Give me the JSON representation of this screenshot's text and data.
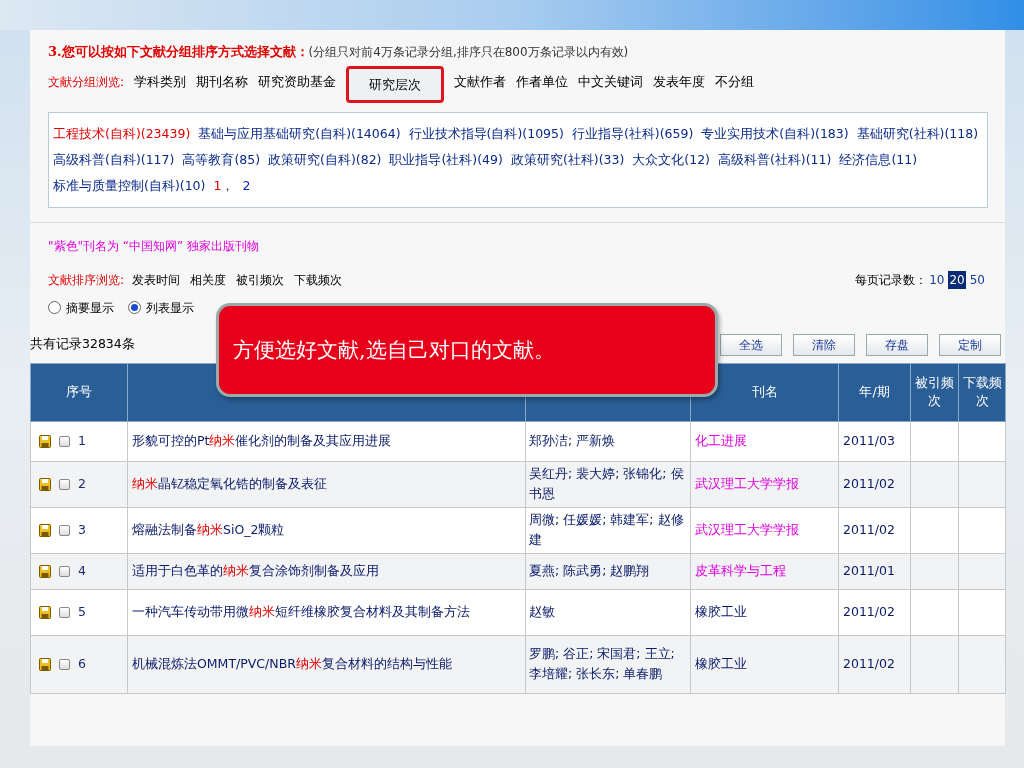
{
  "heading": {
    "title": "3.您可以按如下文献分组排序方式选择文献：",
    "note": "(分组只对前4万条记录分组,排序只在800万条记录以内有效)"
  },
  "group_nav": {
    "label": "文献分组浏览:",
    "items": [
      {
        "label": "学科类别",
        "selected": false
      },
      {
        "label": "期刊名称",
        "selected": false
      },
      {
        "label": "研究资助基金",
        "selected": false
      },
      {
        "label": "研究层次",
        "selected": true
      },
      {
        "label": "文献作者",
        "selected": false
      },
      {
        "label": "作者单位",
        "selected": false
      },
      {
        "label": "中文关键词",
        "selected": false
      },
      {
        "label": "发表年度",
        "selected": false
      },
      {
        "label": "不分组",
        "selected": false
      }
    ]
  },
  "groups": [
    {
      "label": "工程技术(自科)(23439)",
      "selected": true
    },
    {
      "label": "基础与应用基础研究(自科)(14064)",
      "selected": false
    },
    {
      "label": "行业技术指导(自科)(1095)",
      "selected": false
    },
    {
      "label": "行业指导(社科)(659)",
      "selected": false
    },
    {
      "label": "专业实用技术(自科)(183)",
      "selected": false
    },
    {
      "label": "基础研究(社科)(118)",
      "selected": false
    },
    {
      "label": "高级科普(自科)(117)",
      "selected": false
    },
    {
      "label": "高等教育(85)",
      "selected": false
    },
    {
      "label": "政策研究(自科)(82)",
      "selected": false
    },
    {
      "label": "职业指导(社科)(49)",
      "selected": false
    },
    {
      "label": "政策研究(社科)(33)",
      "selected": false
    },
    {
      "label": "大众文化(12)",
      "selected": false
    },
    {
      "label": "高级科普(社科)(11)",
      "selected": false
    },
    {
      "label": "经济信息(11)",
      "selected": false
    },
    {
      "label": "标准与质量控制(自科)(10)",
      "selected": false
    }
  ],
  "group_pages": [
    {
      "label": "1",
      "selected": true
    },
    {
      "label": "2",
      "selected": false
    }
  ],
  "group_pages_separator": "，",
  "exclusive_note": "\"紫色\"刊名为 “中国知网” 独家出版刊物",
  "sort_nav": {
    "label": "文献排序浏览:",
    "items": [
      "发表时间",
      "相关度",
      "被引频次",
      "下载频次"
    ]
  },
  "per_page": {
    "label": "每页记录数：",
    "options": [
      {
        "label": "10",
        "selected": false
      },
      {
        "label": "20",
        "selected": true
      },
      {
        "label": "50",
        "selected": false
      }
    ]
  },
  "display_modes": [
    {
      "label": "摘要显示",
      "selected": false
    },
    {
      "label": "列表显示",
      "selected": true
    }
  ],
  "total": "共有记录32834条",
  "buttons": [
    "全选",
    "清除",
    "存盘",
    "定制"
  ],
  "callout": "方便选好文献,选自己对口的文献。",
  "table": {
    "columns": [
      "序号",
      null,
      null,
      "刊名",
      "年/期",
      "被引频次",
      "下载频次"
    ],
    "rows": [
      {
        "index": "1",
        "checked": false,
        "title": {
          "pre": "形貌可控的Pt",
          "hit": "纳米",
          "post": "催化剂的制备及其应用进展"
        },
        "authors": "郑孙洁; 严新焕",
        "journal": "化工进展",
        "exclusive": true,
        "issue": "2011/03"
      },
      {
        "index": "2",
        "checked": false,
        "title": {
          "hit": "纳米",
          "post": "晶钇稳定氧化锆的制备及表征"
        },
        "authors": "吴红丹; 裴大婷; 张锦化; 侯书恩",
        "journal": "武汉理工大学学报",
        "exclusive": true,
        "issue": "2011/02"
      },
      {
        "index": "3",
        "checked": false,
        "title": {
          "pre": "熔融法制备",
          "hit": "纳米",
          "post": "SiO_2颗粒"
        },
        "authors": "周微; 任媛媛; 韩建军; 赵修建",
        "journal": "武汉理工大学学报",
        "exclusive": true,
        "issue": "2011/02"
      },
      {
        "index": "4",
        "checked": false,
        "title": {
          "pre": "适用于白色革的",
          "hit": "纳米",
          "post": "复合涂饰剂制备及应用"
        },
        "authors": "夏燕; 陈武勇; 赵鹏翔",
        "journal": "皮革科学与工程",
        "exclusive": true,
        "issue": "2011/01"
      },
      {
        "index": "5",
        "checked": false,
        "title": {
          "pre": "一种汽车传动带用微",
          "hit": "纳米",
          "post": "短纤维橡胶复合材料及其制备方法"
        },
        "authors": "赵敏",
        "journal": "橡胶工业",
        "exclusive": false,
        "issue": "2011/02"
      },
      {
        "index": "6",
        "checked": false,
        "title": {
          "pre": "机械混炼法OMMT/PVC/NBR",
          "hit": "纳米",
          "post": "复合材料的结构与性能"
        },
        "authors": "罗鹏; 谷正; 宋国君; 王立; 李培耀; 张长东; 单春鹏",
        "journal": "橡胶工业",
        "exclusive": false,
        "issue": "2011/02"
      }
    ]
  }
}
